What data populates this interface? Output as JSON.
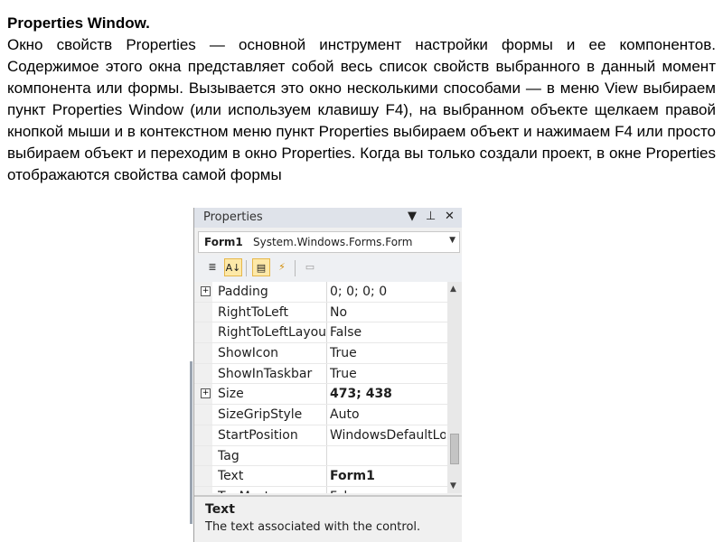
{
  "heading": "Properties Window.",
  "paragraph": "Окно свойств Properties — основной инструмент настройки формы и ее компонентов. Содержимое этого окна представляет собой весь список свойств выбранного в данный момент компонента или формы. Вызывается это окно несколькими способами — в меню View выбираем пункт Properties Window (или используем клавишу F4), на выбранном объекте щелкаем правой кнопкой мыши и в контекстном меню пункт Properties выбираем объект и нажимаем F4 или просто выбираем объект и переходим в окно Properties. Когда вы только создали проект, в окне Properties отображаются свойства самой формы",
  "properties_window": {
    "title": "Properties",
    "title_buttons": {
      "dropdown": "▼",
      "pin": "⊥",
      "close": "✕"
    },
    "object": {
      "name": "Form1",
      "type": "System.Windows.Forms.Form",
      "drop_icon": "▼"
    },
    "toolbar": {
      "categorized_icon": "≣",
      "alphabetical_icon": "A↓",
      "properties_icon": "▤",
      "events_icon": "⚡",
      "property_pages_icon": "▭"
    },
    "rows": [
      {
        "name": "Padding",
        "value": "0; 0; 0; 0",
        "expandable": true,
        "bold": false
      },
      {
        "name": "RightToLeft",
        "value": "No",
        "expandable": false,
        "bold": false
      },
      {
        "name": "RightToLeftLayout",
        "value": "False",
        "expandable": false,
        "bold": false
      },
      {
        "name": "ShowIcon",
        "value": "True",
        "expandable": false,
        "bold": false
      },
      {
        "name": "ShowInTaskbar",
        "value": "True",
        "expandable": false,
        "bold": false
      },
      {
        "name": "Size",
        "value": "473; 438",
        "expandable": true,
        "bold": true
      },
      {
        "name": "SizeGripStyle",
        "value": "Auto",
        "expandable": false,
        "bold": false
      },
      {
        "name": "StartPosition",
        "value": "WindowsDefaultLocation",
        "expandable": false,
        "bold": false
      },
      {
        "name": "Tag",
        "value": "",
        "expandable": false,
        "bold": false
      },
      {
        "name": "Text",
        "value": "Form1",
        "expandable": false,
        "bold": true
      },
      {
        "name": "TopMost",
        "value": "False",
        "expandable": false,
        "bold": false
      }
    ],
    "description": {
      "title": "Text",
      "text": "The text associated with the control."
    },
    "expand_glyph": "+"
  }
}
